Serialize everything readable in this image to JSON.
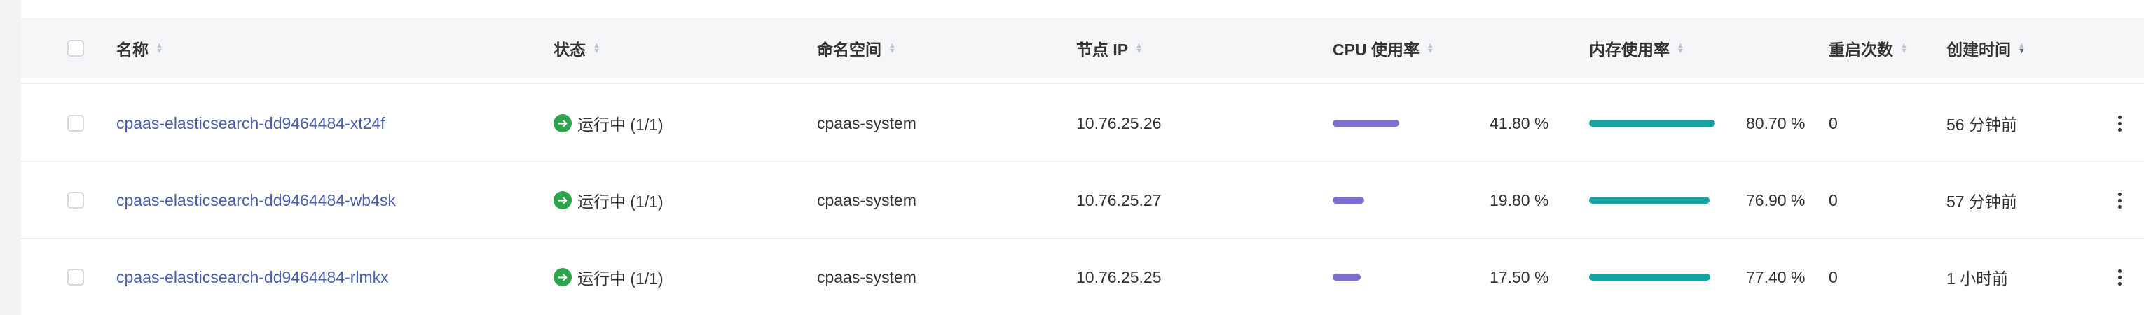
{
  "table": {
    "columns": [
      {
        "label": "名称",
        "sort": "none"
      },
      {
        "label": "状态",
        "sort": "none"
      },
      {
        "label": "命名空间",
        "sort": "none"
      },
      {
        "label": "节点 IP",
        "sort": "none"
      },
      {
        "label": "CPU 使用率",
        "sort": "none"
      },
      {
        "label": "内存使用率",
        "sort": "none"
      },
      {
        "label": "重启次数",
        "sort": "none"
      },
      {
        "label": "创建时间",
        "sort": "desc"
      }
    ],
    "rows": [
      {
        "name": "cpaas-elasticsearch-dd9464484-xt24f",
        "status": "运行中 (1/1)",
        "namespace": "cpaas-system",
        "node_ip": "10.76.25.26",
        "cpu_percent": 41.8,
        "cpu_label": "41.80 %",
        "mem_percent": 80.7,
        "mem_label": "80.70 %",
        "restarts": "0",
        "created": "56 分钟前"
      },
      {
        "name": "cpaas-elasticsearch-dd9464484-wb4sk",
        "status": "运行中 (1/1)",
        "namespace": "cpaas-system",
        "node_ip": "10.76.25.27",
        "cpu_percent": 19.8,
        "cpu_label": "19.80 %",
        "mem_percent": 76.9,
        "mem_label": "76.90 %",
        "restarts": "0",
        "created": "57 分钟前"
      },
      {
        "name": "cpaas-elasticsearch-dd9464484-rlmkx",
        "status": "运行中 (1/1)",
        "namespace": "cpaas-system",
        "node_ip": "10.76.25.25",
        "cpu_percent": 17.5,
        "cpu_label": "17.50 %",
        "mem_percent": 77.4,
        "mem_label": "77.40 %",
        "restarts": "0",
        "created": "1 小时前"
      }
    ]
  },
  "colors": {
    "cpu_bar": "#7b6fd0",
    "mem_bar": "#13a3a3",
    "status_running": "#2ea44f",
    "link": "#4b5fb0"
  },
  "icons": {
    "status": "check-arrow-circle-icon",
    "row_menu": "more-vertical-icon",
    "sort": "sort-caret-icon"
  }
}
